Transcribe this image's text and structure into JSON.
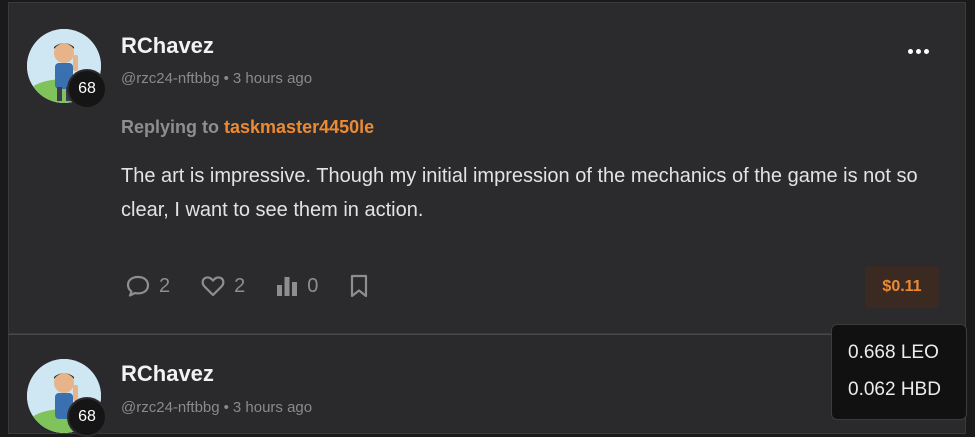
{
  "comments": [
    {
      "author": "RChavez",
      "handle": "@rzc24-nftbbg",
      "time": "3 hours ago",
      "reputation": "68",
      "replying_prefix": "Replying to",
      "replying_to": "taskmaster4450le",
      "body": "The art is impressive. Though my initial impression of the mechanics of the game is not so clear, I want to see them in action.",
      "replies_count": "2",
      "likes_count": "2",
      "stats_count": "0",
      "payout": "$0.11"
    },
    {
      "author": "RChavez",
      "handle": "@rzc24-nftbbg",
      "time": "3 hours ago",
      "reputation": "68"
    }
  ],
  "tooltip": {
    "leo": "0.668 LEO",
    "hbd": "0.062 HBD"
  },
  "icons": {
    "more": "more-options-icon",
    "reply": "comment-bubble-icon",
    "like": "heart-icon",
    "stats": "bar-chart-icon",
    "bookmark": "bookmark-icon"
  },
  "colors": {
    "accent": "#ec8a34",
    "background": "#2b2b2d",
    "payout_bg": "#3b2a22"
  }
}
